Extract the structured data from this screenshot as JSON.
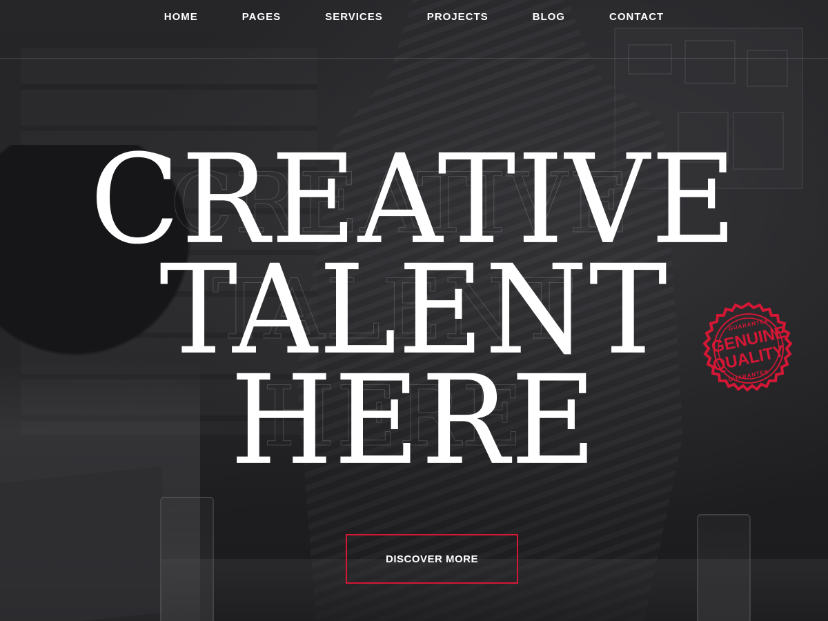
{
  "nav": {
    "items": [
      {
        "label": "HOME"
      },
      {
        "label": "PAGES"
      },
      {
        "label": "SERVICES"
      },
      {
        "label": "PROJECTS"
      },
      {
        "label": "BLOG"
      },
      {
        "label": "CONTACT"
      }
    ]
  },
  "hero": {
    "headline_lines": [
      "CREATIVE",
      "TALENT",
      "HERE"
    ],
    "cta_label": "DISCOVER MORE"
  },
  "badge": {
    "top_word": "GENUINE",
    "bottom_word": "QUALITY",
    "ring_text_top": "GUARANTEE",
    "ring_text_bottom": "GUARANTEE",
    "color": "#d41735"
  },
  "colors": {
    "accent": "#d41735",
    "text": "#ffffff",
    "background": "#262628"
  }
}
